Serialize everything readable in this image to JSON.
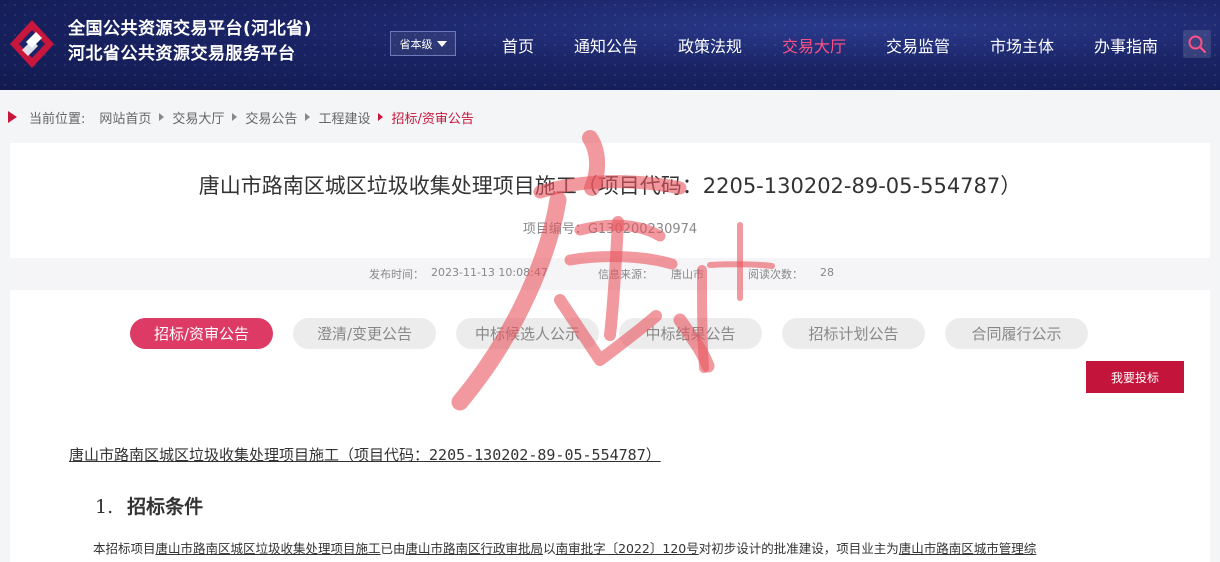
{
  "header": {
    "title_line1": "全国公共资源交易平台(河北省)",
    "title_line2": "河北省公共资源交易服务平台",
    "level_select": "省本级",
    "nav": [
      "首页",
      "通知公告",
      "政策法规",
      "交易大厅",
      "交易监管",
      "市场主体",
      "办事指南"
    ],
    "active_nav": "交易大厅",
    "brand_color": "#c8163c",
    "active_color": "#ff4f86"
  },
  "breadcrumb": {
    "prefix": "当前位置:",
    "items": [
      "网站首页",
      "交易大厅",
      "交易公告",
      "工程建设"
    ],
    "current": "招标/资审公告"
  },
  "article": {
    "title": "唐山市路南区城区垃圾收集处理项目施工（项目代码：2205-130202-89-05-554787）",
    "project_no": "项目编号：G130200230974",
    "meta": {
      "publish_label": "发布时间：",
      "publish_time": "2023-11-13 10:08:47",
      "source_label": "信息来源：",
      "source": "唐山市",
      "views_label": "阅读次数：",
      "views": "28"
    },
    "tabs": [
      "招标/资审公告",
      "澄清/变更公告",
      "中标候选人公示",
      "中标结果公告",
      "招标计划公告",
      "合同履行公示"
    ],
    "active_tab": "招标/资审公告",
    "bid_button": "我要投标",
    "doc_heading": "唐山市路南区城区垃圾收集处理项目施工（项目代码：2205-130202-89-05-554787）",
    "section_num": "1.",
    "section_title": "招标条件",
    "para": {
      "p1": "本招标项目",
      "u1": "唐山市路南区城区垃圾收集处理项目施工",
      "p2": "已由",
      "u2": "唐山市路南区行政审批局",
      "p3": "以",
      "u3": "南审批字〔2022〕120号",
      "p4": "对初步设计的批准建设，项目业主为",
      "u4": "唐山市路南区城市管理综"
    }
  },
  "watermark": {
    "color": "#e8555d"
  }
}
